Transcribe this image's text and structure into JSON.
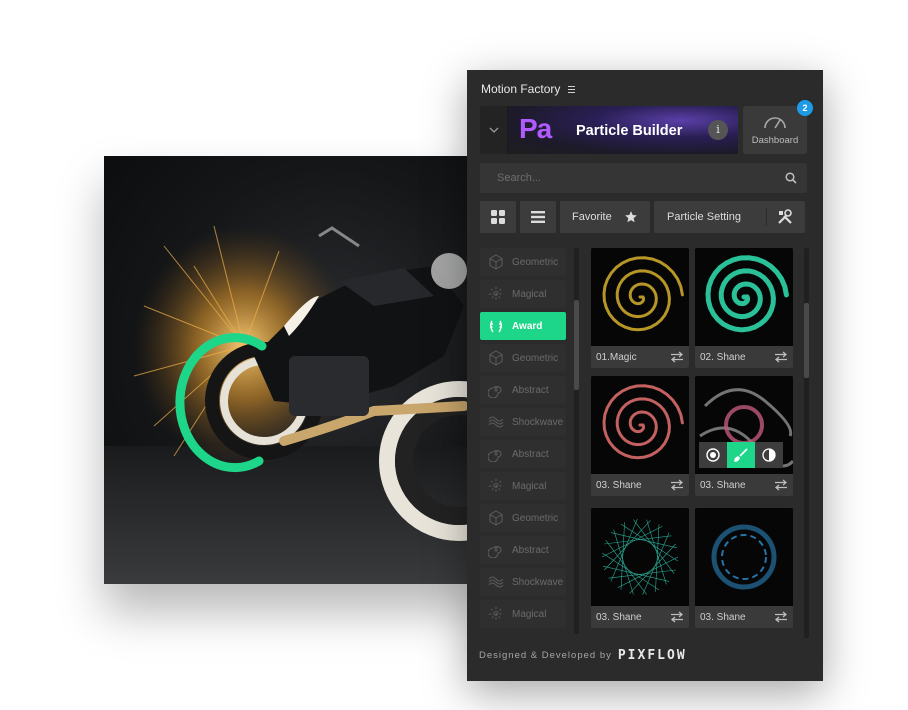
{
  "panel": {
    "app_title": "Motion Factory",
    "plugin_logo": "Pa",
    "plugin_title": "Particle Builder",
    "info_label": "i",
    "dashboard_label": "Dashboard",
    "dashboard_badge": "2",
    "search_placeholder": "Search...",
    "favorite_label": "Favorite",
    "particle_setting_label": "Particle Setting",
    "footer_text": "Designed & Developed by",
    "brand": "PIXFLOW"
  },
  "categories": [
    {
      "label": "Geometric",
      "icon": "cube-icon",
      "active": false
    },
    {
      "label": "Magical",
      "icon": "sparkle-icon",
      "active": false
    },
    {
      "label": "Award",
      "icon": "laurel-icon",
      "active": true
    },
    {
      "label": "Geometric",
      "icon": "cube-icon",
      "active": false
    },
    {
      "label": "Abstract",
      "icon": "swirl-icon",
      "active": false
    },
    {
      "label": "Shockwave",
      "icon": "wave-icon",
      "active": false
    },
    {
      "label": "Abstract",
      "icon": "swirl-icon",
      "active": false
    },
    {
      "label": "Magical",
      "icon": "sparkle-icon",
      "active": false
    },
    {
      "label": "Geometric",
      "icon": "cube-icon",
      "active": false
    },
    {
      "label": "Abstract",
      "icon": "swirl-icon",
      "active": false
    },
    {
      "label": "Shockwave",
      "icon": "wave-icon",
      "active": false
    },
    {
      "label": "Magical",
      "icon": "sparkle-icon",
      "active": false
    }
  ],
  "presets": [
    {
      "label": "01.Magic",
      "color": "#c9a62a"
    },
    {
      "label": "02. Shane",
      "color": "#2fd6a8"
    },
    {
      "label": "03. Shane",
      "color": "#d86a6a"
    },
    {
      "label": "03. Shane",
      "color": "#c05a7a"
    },
    {
      "label": "03. Shane",
      "color": "#2fc8b0"
    },
    {
      "label": "03. Shane",
      "color": "#2f8fd0"
    }
  ],
  "colors": {
    "accent": "#1ed68a",
    "badge": "#1e9be6",
    "plugin": "#b15bff"
  }
}
